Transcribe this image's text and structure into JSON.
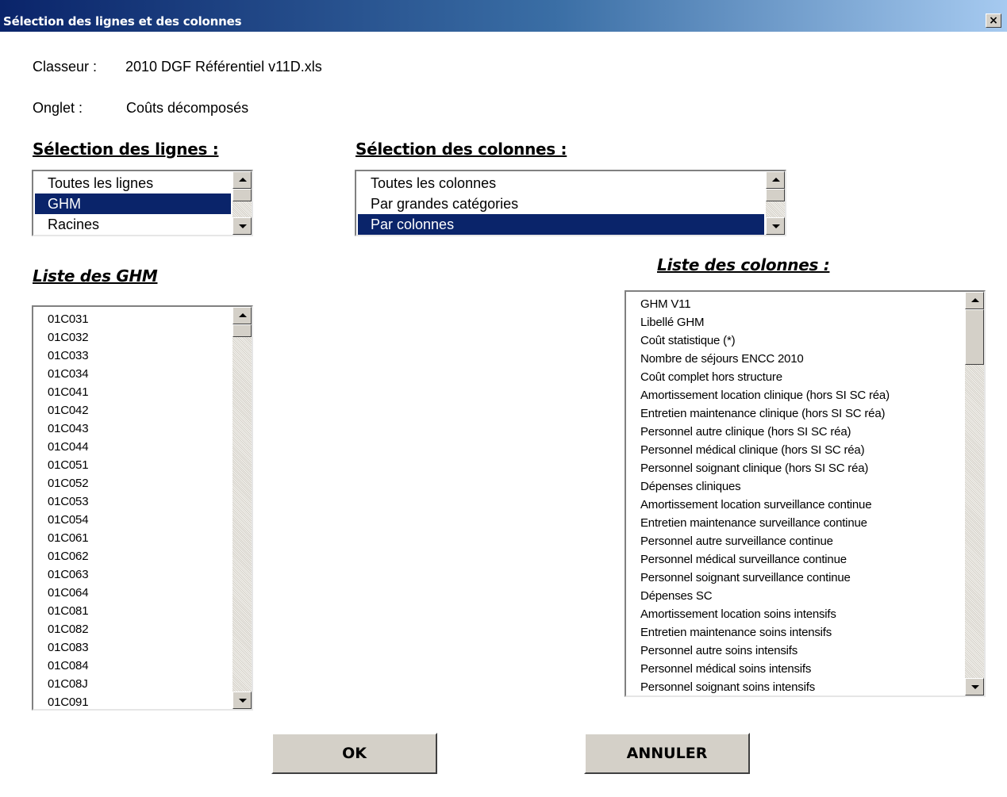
{
  "window": {
    "title": "Sélection des lignes et des colonnes",
    "close_glyph": "×"
  },
  "info": {
    "workbook_label": "Classeur :",
    "workbook_value": "2010 DGF Référentiel v11D.xls",
    "sheet_label": "Onglet :",
    "sheet_value": "Coûts décomposés"
  },
  "rows_selection": {
    "title": "Sélection des lignes :",
    "options": [
      "Toutes les lignes",
      "GHM",
      "Racines"
    ],
    "selected": "GHM"
  },
  "columns_selection": {
    "title": "Sélection des colonnes :",
    "options": [
      "Toutes les colonnes",
      "Par grandes catégories",
      "Par colonnes"
    ],
    "selected": "Par colonnes"
  },
  "ghm_list": {
    "title": "Liste des GHM",
    "items": [
      "01C031",
      "01C032",
      "01C033",
      "01C034",
      "01C041",
      "01C042",
      "01C043",
      "01C044",
      "01C051",
      "01C052",
      "01C053",
      "01C054",
      "01C061",
      "01C062",
      "01C063",
      "01C064",
      "01C081",
      "01C082",
      "01C083",
      "01C084",
      "01C08J",
      "01C091"
    ]
  },
  "columns_list": {
    "title": "Liste des colonnes :",
    "items": [
      "GHM V11",
      "Libellé GHM",
      "Coût statistique (*)",
      "Nombre de séjours ENCC 2010",
      "Coût complet hors structure",
      "Amortissement location clinique (hors SI SC réa)",
      "Entretien maintenance clinique (hors SI SC réa)",
      "Personnel autre  clinique (hors SI SC réa)",
      "Personnel médical clinique (hors SI SC réa)",
      "Personnel soignant clinique (hors SI SC réa)",
      "Dépenses cliniques",
      "Amortissement location surveillance continue",
      "Entretien maintenance surveillance continue",
      "Personnel autre  surveillance continue",
      "Personnel médical surveillance continue",
      "Personnel soignant surveillance continue",
      "Dépenses SC",
      "Amortissement location soins intensifs",
      "Entretien maintenance soins intensifs",
      "Personnel autre  soins intensifs",
      "Personnel médical soins intensifs",
      "Personnel soignant soins intensifs"
    ]
  },
  "buttons": {
    "ok": "OK",
    "cancel": "ANNULER"
  },
  "colors": {
    "selection_bg": "#0a246a",
    "button_face": "#d4d0c8",
    "title_gradient_start": "#0a246a",
    "title_gradient_end": "#a6caf0"
  }
}
